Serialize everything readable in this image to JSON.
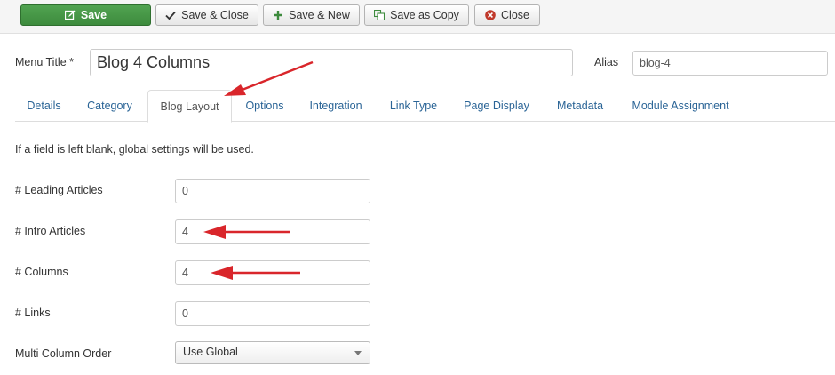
{
  "toolbar": {
    "save_label": "Save",
    "save_close_label": "Save & Close",
    "save_new_label": "Save & New",
    "save_copy_label": "Save as Copy",
    "close_label": "Close"
  },
  "header": {
    "menu_title_label": "Menu Title *",
    "menu_title_value": "Blog 4 Columns",
    "alias_label": "Alias",
    "alias_value": "blog-4"
  },
  "tabs": [
    {
      "label": "Details"
    },
    {
      "label": "Category"
    },
    {
      "label": "Blog Layout",
      "active": true
    },
    {
      "label": "Options"
    },
    {
      "label": "Integration"
    },
    {
      "label": "Link Type"
    },
    {
      "label": "Page Display"
    },
    {
      "label": "Metadata"
    },
    {
      "label": "Module Assignment"
    }
  ],
  "form": {
    "hint": "If a field is left blank, global settings will be used.",
    "fields": [
      {
        "label": "# Leading Articles",
        "value": "0"
      },
      {
        "label": "# Intro Articles",
        "value": "4"
      },
      {
        "label": "# Columns",
        "value": "4"
      },
      {
        "label": "# Links",
        "value": "0"
      }
    ],
    "multi_column_order": {
      "label": "Multi Column Order",
      "value": "Use Global"
    }
  },
  "colors": {
    "save_green": "#51a351",
    "link_blue": "#2a6496",
    "annotation_red": "#d9262b",
    "close_icon_red": "#c0392b"
  }
}
